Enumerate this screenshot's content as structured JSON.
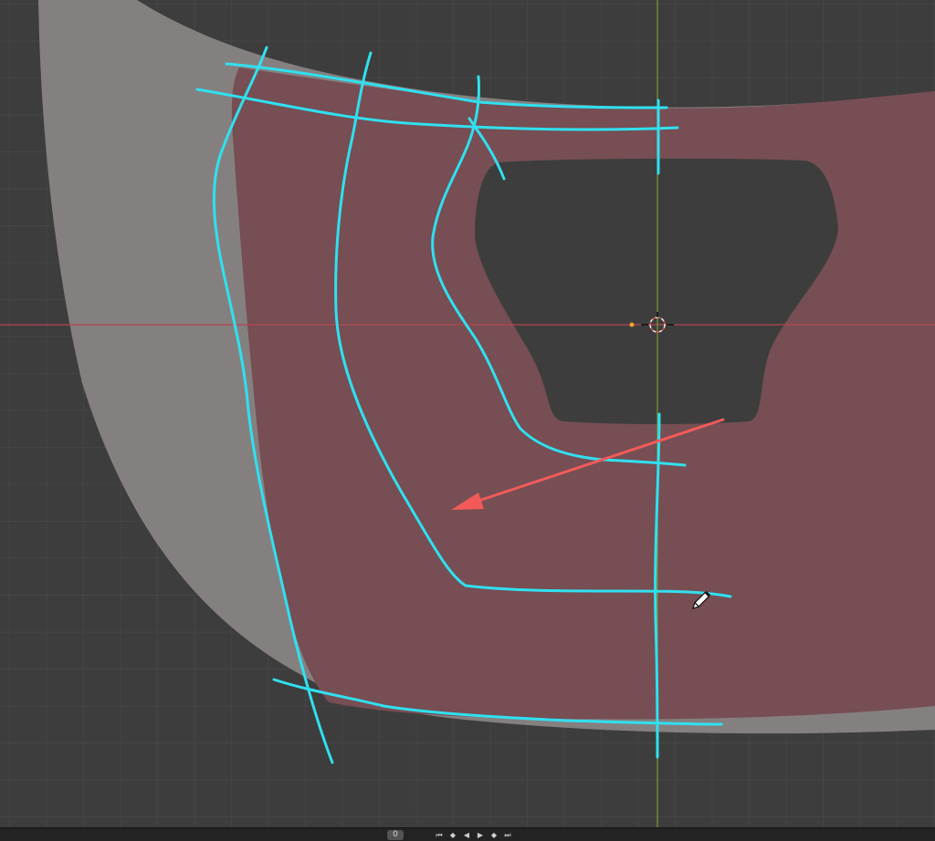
{
  "viewport": {
    "name": "3D Viewport",
    "colors": {
      "background": "#3d3d3d",
      "grid": "#464646",
      "x_axis": "#b5444f",
      "z_axis": "#7a9a3a",
      "mesh_light": "#858080",
      "mesh_selected": "#764e53",
      "annotation_stroke": "#30e0f0",
      "arrow": "#f25a5a"
    },
    "icons": [
      "3d-cursor-icon",
      "object-origin-icon",
      "pencil-cursor-icon"
    ]
  },
  "timeline": {
    "current_frame": "0",
    "controls": [
      "jump-to-start-icon",
      "jump-to-keyframe-prev-icon",
      "play-reverse-icon",
      "play-icon",
      "jump-to-keyframe-next-icon",
      "jump-to-end-icon"
    ]
  }
}
